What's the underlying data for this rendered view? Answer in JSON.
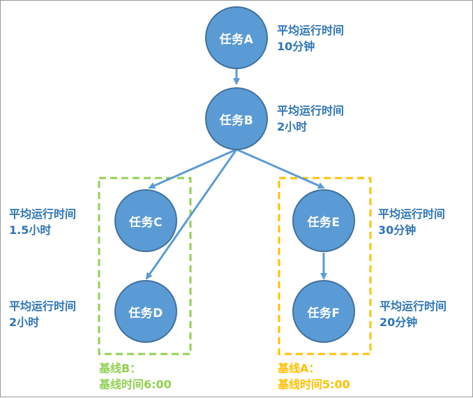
{
  "colors": {
    "node_fill": "#5b9bd5",
    "node_border": "#41719c",
    "text_blue": "#2e75b6",
    "arrow": "#5b9bd5",
    "group_b": "#92d050",
    "group_a": "#ffc000"
  },
  "nodes": {
    "A": {
      "label": "任务A",
      "info_line1": "平均运行时间",
      "info_line2": "10分钟"
    },
    "B": {
      "label": "任务B",
      "info_line1": "平均运行时间",
      "info_line2": "2小时"
    },
    "C": {
      "label": "任务C",
      "info_line1": "平均运行时间",
      "info_line2": "1.5小时"
    },
    "D": {
      "label": "任务D",
      "info_line1": "平均运行时间",
      "info_line2": "2小时"
    },
    "E": {
      "label": "任务E",
      "info_line1": "平均运行时间",
      "info_line2": "30分钟"
    },
    "F": {
      "label": "任务F",
      "info_line1": "平均运行时间",
      "info_line2": "20分钟"
    }
  },
  "edges": [
    {
      "from": "A",
      "to": "B"
    },
    {
      "from": "B",
      "to": "C"
    },
    {
      "from": "B",
      "to": "D"
    },
    {
      "from": "B",
      "to": "E"
    },
    {
      "from": "E",
      "to": "F"
    }
  ],
  "groups": {
    "B": {
      "line1": "基线B：",
      "line2": "基线时间6:00"
    },
    "A": {
      "line1": "基线A：",
      "line2": "基线时间5:00"
    }
  }
}
